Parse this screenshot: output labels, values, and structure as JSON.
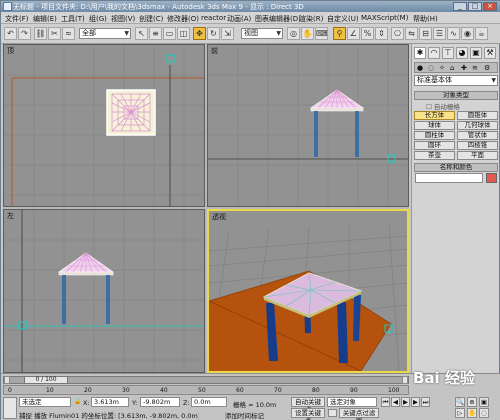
{
  "window": {
    "title": "无标题  - 项目文件夹: D:\\用户\\我的文档\\3dsmax  - Autodesk 3ds Max 9  - 显示 : Direct 3D",
    "controls": [
      "_",
      "□",
      "×"
    ]
  },
  "menubar": {
    "items": [
      "文件(F)",
      "编辑(E)",
      "工具(T)",
      "组(G)",
      "视图(V)",
      "创建(C)",
      "修改器(O)",
      "reactor",
      "动画(A)",
      "图表编辑器(D)",
      "渲染(R)",
      "自定义(U)",
      "MAXScript(M)",
      "帮助(H)"
    ]
  },
  "toolbar": {
    "selection_filter": "全部",
    "reference_coord": "视图"
  },
  "viewports": [
    {
      "label": "顶"
    },
    {
      "label": "前"
    },
    {
      "label": "左"
    },
    {
      "label": "透视"
    }
  ],
  "command_panel": {
    "category_dropdown": "标准基本体",
    "rollout_object_type": "对象类型",
    "autogrid_label": "自动栅格",
    "object_buttons": [
      "长方体",
      "圆锥体",
      "球体",
      "几何球体",
      "圆柱体",
      "管状体",
      "圆环",
      "四棱锥",
      "茶壶",
      "平面"
    ],
    "rollout_name_color": "名称和颜色",
    "active_color": "#e05a50"
  },
  "timeline": {
    "frame_counter": "0 / 100",
    "ticks": [
      "0",
      "10",
      "20",
      "30",
      "40",
      "50",
      "60",
      "70",
      "80",
      "90",
      "100"
    ]
  },
  "status": {
    "selection_text": "未选定",
    "prompt_text": "捕捉 播放 Flumin01 的坐标位置: [3.613m, -9.802m, 0.0m]",
    "x_label": "X:",
    "x_value": "3.613m",
    "y_label": "Y:",
    "y_value": "-9.802m",
    "z_label": "Z:",
    "z_value": "0.0m",
    "grid_text": "栅格 = 10.0m",
    "add_time_tag": "添加时间标记",
    "auto_key": "自动关键点",
    "set_key": "设置关键点",
    "selected_dropdown": "选定对象",
    "key_filters": "关键点过滤器"
  },
  "watermark": "Bai 经验"
}
